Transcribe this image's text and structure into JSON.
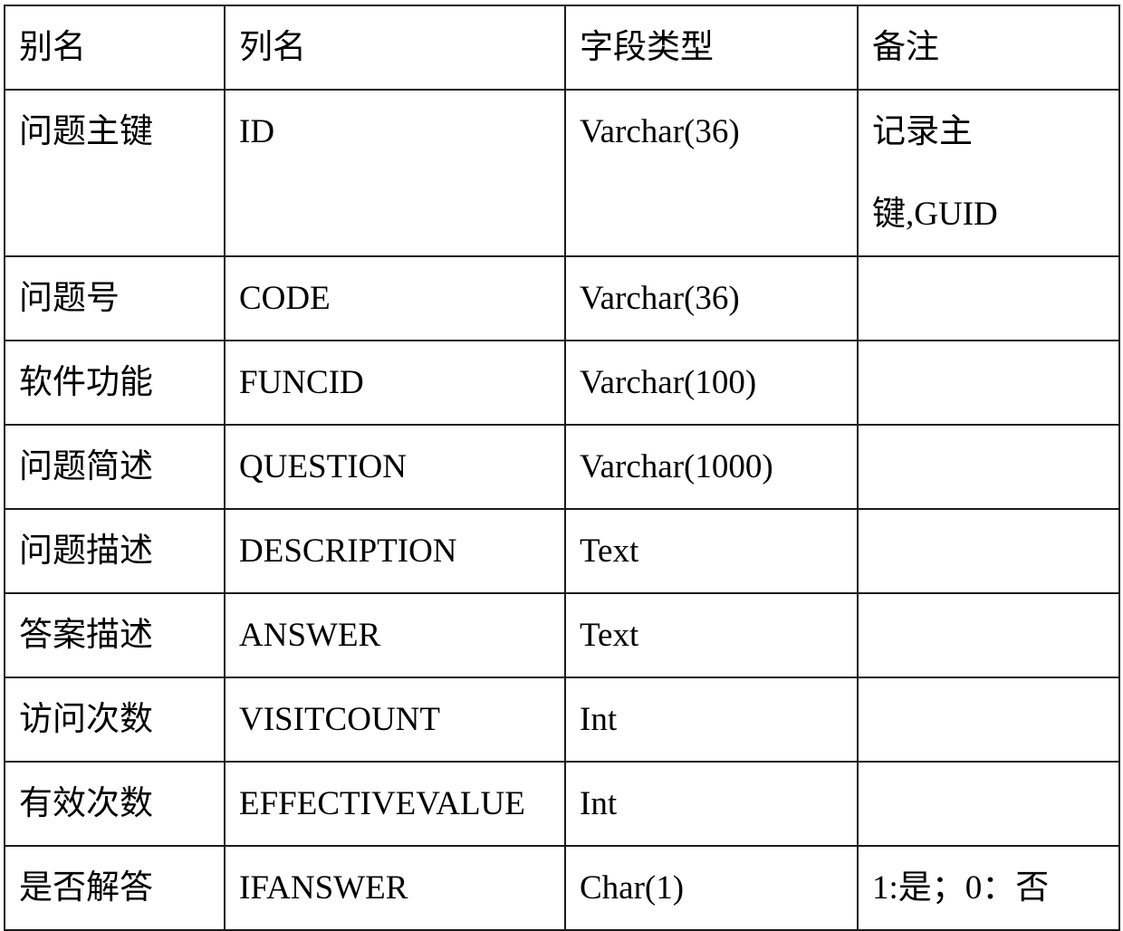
{
  "table": {
    "headers": [
      "别名",
      "列名",
      "字段类型",
      "备注"
    ],
    "rows": [
      {
        "alias": "问题主键",
        "column": "ID",
        "type": "Varchar(36)",
        "note": "记录主\n键,GUID"
      },
      {
        "alias": "问题号",
        "column": "CODE",
        "type": "Varchar(36)",
        "note": ""
      },
      {
        "alias": "软件功能",
        "column": "FUNCID",
        "type": "Varchar(100)",
        "note": ""
      },
      {
        "alias": "问题简述",
        "column": "QUESTION",
        "type": "Varchar(1000)",
        "note": ""
      },
      {
        "alias": "问题描述",
        "column": "DESCRIPTION",
        "type": "Text",
        "note": ""
      },
      {
        "alias": "答案描述",
        "column": "ANSWER",
        "type": "Text",
        "note": ""
      },
      {
        "alias": "访问次数",
        "column": "VISITCOUNT",
        "type": "Int",
        "note": ""
      },
      {
        "alias": "有效次数",
        "column": "EFFECTIVEVALUE",
        "type": "Int",
        "note": ""
      },
      {
        "alias": "是否解答",
        "column": "IFANSWER",
        "type": "Char(1)",
        "note": "1:是；0：否"
      }
    ]
  }
}
